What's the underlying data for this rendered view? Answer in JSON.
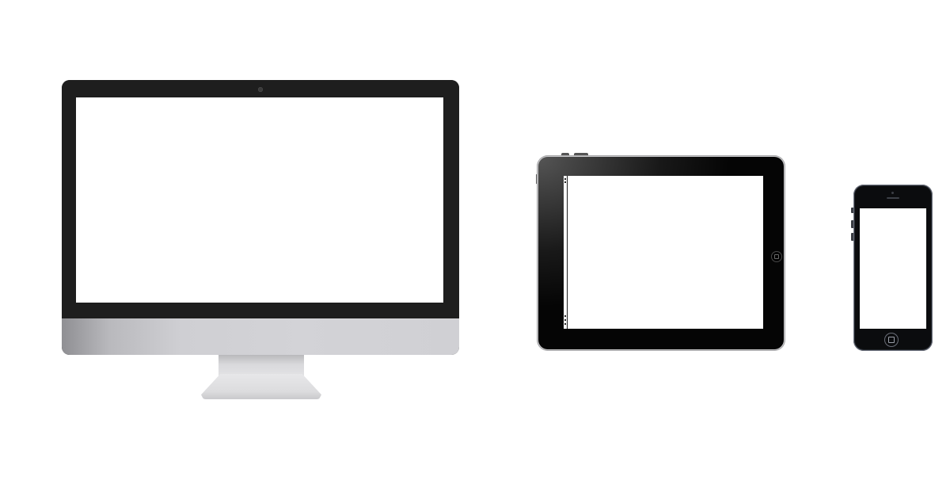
{
  "devices": [
    {
      "kind": "desktop-monitor",
      "screen_color": "#ffffff",
      "bezel_color": "#1e1e1e",
      "chin_color": "#d0d0d4"
    },
    {
      "kind": "tablet",
      "screen_color": "#ffffff",
      "bezel_color": "#050505"
    },
    {
      "kind": "phone",
      "screen_color": "#ffffff",
      "bezel_color": "#0b0c0e"
    }
  ],
  "background_color": "#ffffff"
}
